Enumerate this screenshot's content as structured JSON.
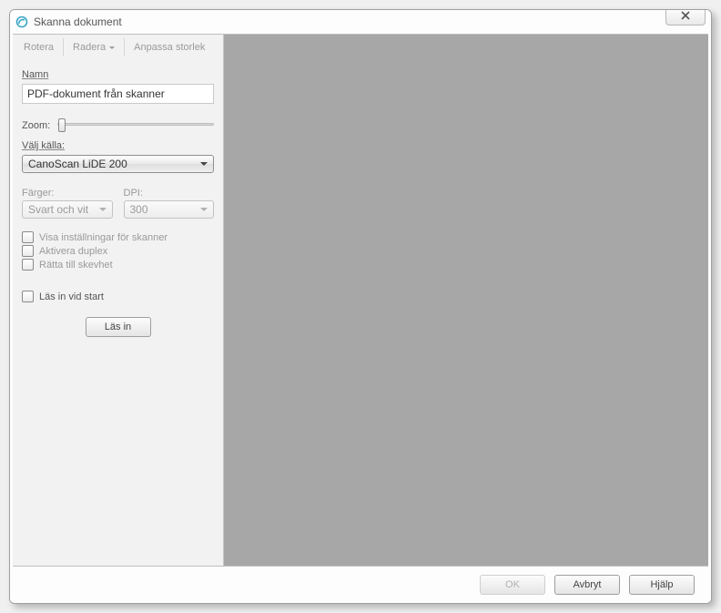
{
  "window": {
    "title": "Skanna dokument"
  },
  "toolbar": {
    "rotate": "Rotera",
    "delete": "Radera",
    "fit": "Anpassa storlek"
  },
  "labels": {
    "name": "Namn",
    "zoom": "Zoom:",
    "source": "Välj källa:",
    "colors": "Färger:",
    "dpi": "DPI:"
  },
  "fields": {
    "name_value": "PDF-dokument från skanner",
    "source_selected": "CanoScan LiDE 200",
    "colors_selected": "Svart och vit",
    "dpi_selected": "300"
  },
  "checkboxes": {
    "show_scanner_settings": "Visa inställningar för skanner",
    "enable_duplex": "Aktivera duplex",
    "deskew": "Rätta till skevhet",
    "scan_on_start": "Läs in vid start"
  },
  "buttons": {
    "scan": "Läs in",
    "ok": "OK",
    "cancel": "Avbryt",
    "help": "Hjälp"
  }
}
